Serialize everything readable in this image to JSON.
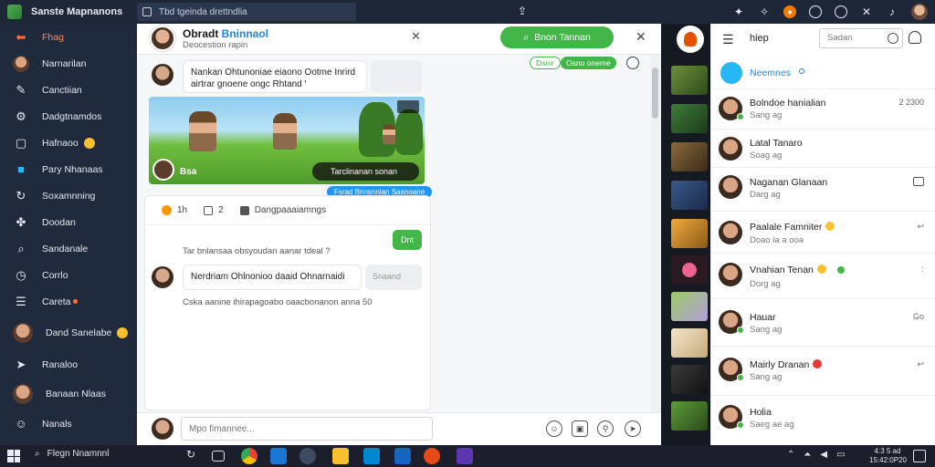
{
  "window": {
    "title": "Sanste Mapnanons",
    "url": "Tbd tgeinda drettndlia"
  },
  "sidebar": {
    "items": [
      {
        "label": "Fhag",
        "icon": "back-arrow-icon",
        "active": true
      },
      {
        "label": "Narnarilan",
        "icon": "avatar"
      },
      {
        "label": "Canctiian",
        "icon": "paint-brush-icon"
      },
      {
        "label": "Dadgtnamdos",
        "icon": "settings-gear-icon"
      },
      {
        "label": "Hafnaoo",
        "icon": "chat-icon",
        "emoji": true
      },
      {
        "label": "Pary Nhanaas",
        "icon": "folder-icon"
      },
      {
        "label": "Soxamnning",
        "icon": "refresh-icon"
      },
      {
        "label": "Doodan",
        "icon": "tag-icon"
      },
      {
        "label": "Sandanale",
        "icon": "search-icon"
      },
      {
        "label": "Corrlo",
        "icon": "clock-icon"
      },
      {
        "label": "Careta",
        "icon": "list-icon",
        "dot": true
      },
      {
        "label": "Dand Sanelabe",
        "icon": "avatar",
        "emoji": true
      },
      {
        "label": "Ranaloo",
        "icon": "send-icon"
      },
      {
        "label": "Banaan Nlaas",
        "icon": "avatar"
      },
      {
        "label": "Nanals",
        "icon": "emoji-icon"
      }
    ]
  },
  "chat": {
    "header_name_prefix": "Obradt ",
    "header_name_accent": "Bninnaol",
    "header_sub": "Deocestion rapin",
    "header_button": "Bnon Tannan",
    "pills": [
      "Dsnir",
      "Osno oneme"
    ],
    "messages": {
      "first_bubble": "Nankan Ohtunoniae eiaono Ootme Inrird airtrar gnoene ongc Rhtand '",
      "game_label": "Bsa",
      "game_pill": "Tarclinanan sonan",
      "blue_pill": "Fsrad Bnnsnnian Saanoane",
      "react_like": "1h",
      "react_count": "2",
      "react_text": "Dangpaaaiamngs",
      "green_reply": "Dnt",
      "system_line": "Tar bnlansaa obsyoudan aanar tdeal ?",
      "second_bubble": "Nerdriam Ohlnonioo daaid Ohnarnaidi",
      "ghost_label": "Snaand",
      "footer_line": "Cska aanine ihirapagoabo oaacbonanon anna 50"
    },
    "input_placeholder": "Mpo fimannee...",
    "input_icons": [
      "emoji-icon",
      "image-icon",
      "attach-icon",
      "send-icon"
    ]
  },
  "right_panel": {
    "title": "hiep",
    "search_placeholder": "Sadan",
    "selected": "Neemnes",
    "items": [
      {
        "name": "Bolndoe hanialian",
        "sub": "Sang ag",
        "meta": "2 2300",
        "online": true
      },
      {
        "name": "Latal Tanaro",
        "sub": "Soag ag",
        "meta": ""
      },
      {
        "name": "Naganan Glanaan",
        "sub": "Darg ag",
        "meta": "box"
      },
      {
        "name": "Paalale Famniter",
        "sub": "Doao ia a ooa",
        "meta": "",
        "emoji": "#fbc02d"
      },
      {
        "name": "Vnahian Tenan",
        "sub": "Dorg ag",
        "meta": ":",
        "emoji": "#fbc02d",
        "online": true
      },
      {
        "name": "Hauar",
        "sub": "Sang ag",
        "meta": "Go"
      },
      {
        "name": "Mairly Dranan",
        "sub": "Sang ag",
        "meta": "",
        "emoji": "#e53935"
      },
      {
        "name": "Holia",
        "sub": "Saeg ae ag",
        "meta": ""
      }
    ]
  },
  "taskbar": {
    "search": "Flegn Nnamnnl",
    "clock_time": "4:3 5 ad",
    "clock_date": "15:42:0P20"
  },
  "colors": {
    "accent_green": "#43b649",
    "accent_blue": "#1e88e5",
    "accent_orange": "#ff7043",
    "sidebar_bg": "#1f2a3d"
  }
}
